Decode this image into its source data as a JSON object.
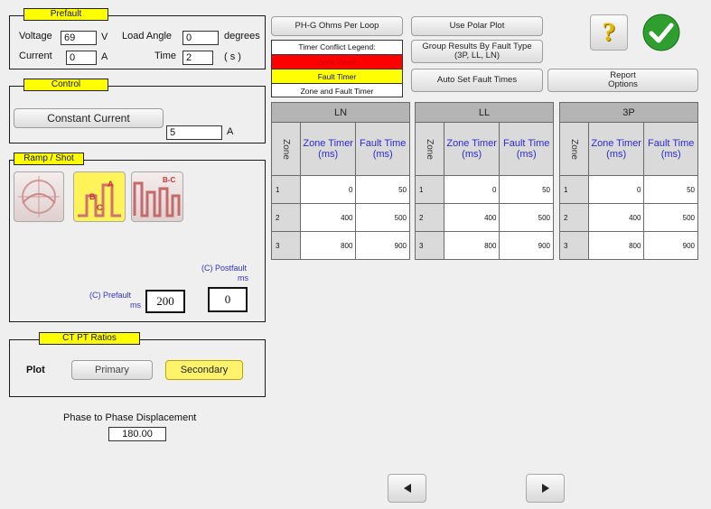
{
  "prefault": {
    "title": "Prefault",
    "voltage_label": "Voltage",
    "voltage_value": "69",
    "voltage_unit": "V",
    "load_angle_label": "Load Angle",
    "load_angle_value": "0",
    "load_angle_unit": "degrees",
    "current_label": "Current",
    "current_value": "0",
    "current_unit": "A",
    "time_label": "Time",
    "time_value": "2",
    "time_unit": "( s )"
  },
  "control": {
    "title": "Control",
    "constant_current_label": "Constant Current",
    "amps_value": "5",
    "amps_unit": "A"
  },
  "ramp": {
    "title": "Ramp / Shot",
    "icon_label_a": "A",
    "icon_label_b": "B",
    "icon_label_c": "C",
    "icon_label_bc": "B-C",
    "postfault_label": "(C) Postfault",
    "postfault_unit": "ms",
    "postfault_value": "0",
    "prefault_label": "(C) Prefault",
    "prefault_unit": "ms",
    "prefault_value": "200"
  },
  "ctpt": {
    "title": "CT PT Ratios",
    "plot_label": "Plot",
    "primary_label": "Primary",
    "secondary_label": "Secondary"
  },
  "phase": {
    "label": "Phase to Phase Displacement",
    "value": "180.00"
  },
  "toolbar": {
    "ph_g_label": "PH-G Ohms Per Loop",
    "use_polar_label": "Use Polar Plot",
    "group_results_label1": "Group Results By Fault Type",
    "group_results_label2": "(3P, LL, LN)",
    "auto_set_label": "Auto Set Fault Times",
    "report_label1": "Report",
    "report_label2": "Options"
  },
  "timer_legend": {
    "title": "Timer Conflict Legend:",
    "zone_timer": "Zone Timer",
    "fault_timer": "Fault Timer",
    "zone_and_fault": "Zone and Fault Timer"
  },
  "colors": {
    "zone_timer": "#ff0000",
    "fault_timer": "#ffff00",
    "header_bg": "#b4b4b4",
    "header_text": "#2b2bd0",
    "check": "#2e9e2e"
  },
  "tables": {
    "zone_header": "Zone",
    "zone_timer_header": "Zone Timer (ms)",
    "fault_time_header": "Fault Time (ms)",
    "sections": [
      {
        "name": "LN",
        "rows": [
          {
            "zone": "1",
            "zone_timer": "0",
            "fault_time": "50"
          },
          {
            "zone": "2",
            "zone_timer": "400",
            "fault_time": "500"
          },
          {
            "zone": "3",
            "zone_timer": "800",
            "fault_time": "900"
          }
        ]
      },
      {
        "name": "LL",
        "rows": [
          {
            "zone": "1",
            "zone_timer": "0",
            "fault_time": "50"
          },
          {
            "zone": "2",
            "zone_timer": "400",
            "fault_time": "500"
          },
          {
            "zone": "3",
            "zone_timer": "800",
            "fault_time": "900"
          }
        ]
      },
      {
        "name": "3P",
        "rows": [
          {
            "zone": "1",
            "zone_timer": "0",
            "fault_time": "50"
          },
          {
            "zone": "2",
            "zone_timer": "400",
            "fault_time": "500"
          },
          {
            "zone": "3",
            "zone_timer": "800",
            "fault_time": "900"
          }
        ]
      }
    ]
  },
  "nav": {
    "prev_icon": "left-triangle-icon",
    "next_icon": "right-triangle-icon"
  },
  "icons": {
    "help": "?"
  }
}
